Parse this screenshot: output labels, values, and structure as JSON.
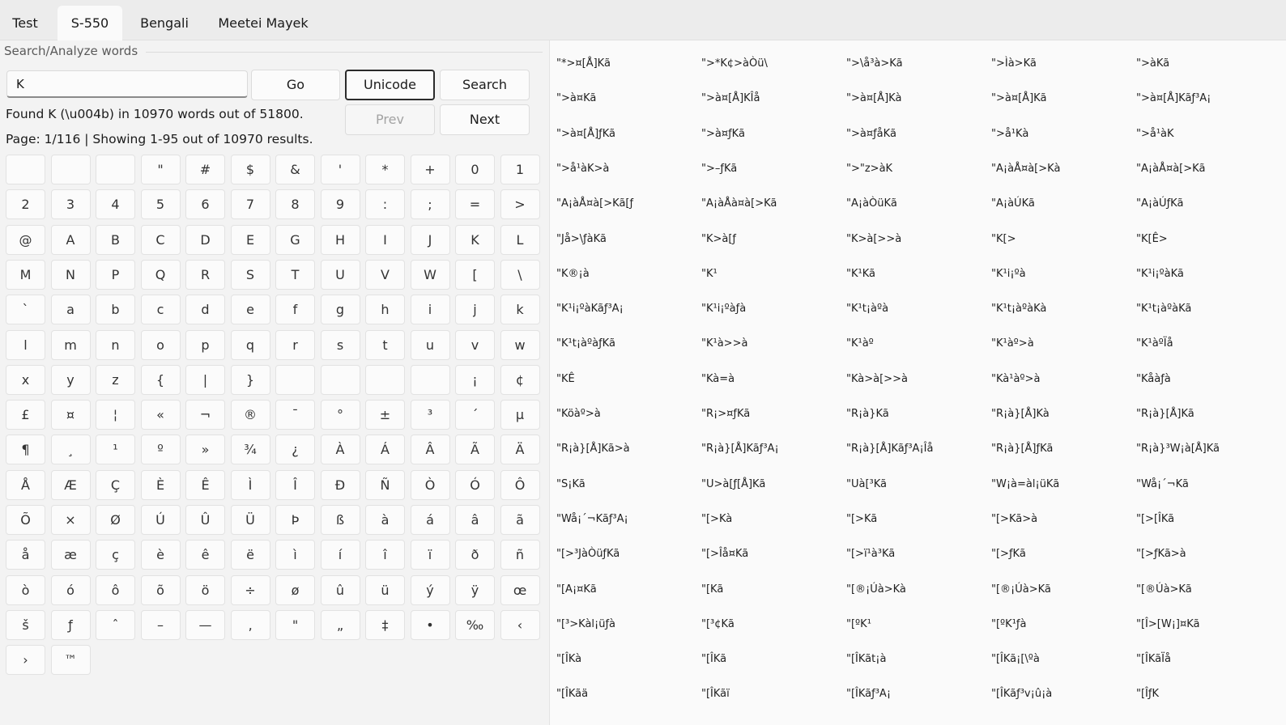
{
  "tabs": [
    "Test",
    "S-550",
    "Bengali",
    "Meetei Mayek"
  ],
  "active_tab": 1,
  "section_label": "Search/Analyze words",
  "search": {
    "value": "K",
    "placeholder": ""
  },
  "buttons": {
    "go": "Go",
    "unicode": "Unicode",
    "search": "Search",
    "prev": "Prev",
    "next": "Next"
  },
  "found_text": "Found K (\\u004b) in 10970 words out of 51800.",
  "page_text": "Page: 1/116 | Showing 1-95 out of 10970 results.",
  "keys": [
    "",
    "",
    "",
    "\"",
    "#",
    "$",
    "&",
    "'",
    "*",
    "+",
    "0",
    "1",
    "2",
    "3",
    "4",
    "5",
    "6",
    "7",
    "8",
    "9",
    ":",
    ";",
    "=",
    ">",
    "@",
    "A",
    "B",
    "C",
    "D",
    "E",
    "G",
    "H",
    "I",
    "J",
    "K",
    "L",
    "M",
    "N",
    "P",
    "Q",
    "R",
    "S",
    "T",
    "U",
    "V",
    "W",
    "[",
    "\\",
    "`",
    "a",
    "b",
    "c",
    "d",
    "e",
    "f",
    "g",
    "h",
    "i",
    "j",
    "k",
    "l",
    "m",
    "n",
    "o",
    "p",
    "q",
    "r",
    "s",
    "t",
    "u",
    "v",
    "w",
    "x",
    "y",
    "z",
    "{",
    "|",
    "}",
    "",
    "",
    "",
    "",
    "¡",
    "¢",
    "£",
    "¤",
    "¦",
    "«",
    "¬",
    "®",
    "¯",
    "°",
    "±",
    "³",
    "´",
    "µ",
    "¶",
    "¸",
    "¹",
    "º",
    "»",
    "¾",
    "¿",
    "À",
    "Á",
    "Â",
    "Ã",
    "Ä",
    "Å",
    "Æ",
    "Ç",
    "È",
    "Ê",
    "Ì",
    "Î",
    "Ð",
    "Ñ",
    "Ò",
    "Ó",
    "Ô",
    "Õ",
    "×",
    "Ø",
    "Ú",
    "Û",
    "Ü",
    "Þ",
    "ß",
    "à",
    "á",
    "â",
    "ã",
    "å",
    "æ",
    "ç",
    "è",
    "ê",
    "ë",
    "ì",
    "í",
    "î",
    "ï",
    "ð",
    "ñ",
    "ò",
    "ó",
    "ô",
    "õ",
    "ö",
    "÷",
    "ø",
    "û",
    "ü",
    "ý",
    "ÿ",
    "œ",
    "š",
    "ƒ",
    "ˆ",
    "–",
    "—",
    "‚",
    "\"",
    "„",
    "‡",
    "•",
    "‰",
    "‹",
    "›",
    "™"
  ],
  "results": [
    "\"*>¤[Å]Kã",
    "\">*K¢>àÒü\\",
    "\">\\å³à>Kã",
    "\">Ìà>Kã",
    "\">àKã",
    "\">à¤Kã",
    "\">à¤[Å]KÎå",
    "\">à¤[Å]Kà",
    "\">à¤[Å]Kã",
    "\">à¤[Å]Kãƒ³A¡",
    "\">à¤[Å]ƒKã",
    "\">à¤ƒKã",
    "\">à¤ƒåKã",
    "\">å¹Kà",
    "\">å¹àK",
    "\">å¹àK>à",
    "\">–ƒKã",
    "\">\"z>àK",
    "\"A¡àÅ¤à[>Kà",
    "\"A¡àÅ¤à[>Kã",
    "\"A¡àÅ¤à[>Kã[ƒ",
    "\"A¡àÅà¤à[>Kã",
    "\"A¡àÒüKã",
    "\"A¡àÚKã",
    "\"A¡àÚƒKã",
    "\"Jå>\\ƒàKã",
    "\"K>à[ƒ",
    "\"K>à[>>à",
    "\"K[>",
    "\"K[Ê>",
    "\"K®¡à",
    "\"K¹",
    "\"K¹Kã",
    "\"K¹i¡ºà",
    "\"K¹i¡ºàKã",
    "\"K¹i¡ºàKãƒ³A¡",
    "\"K¹i¡ºàƒà",
    "\"K¹t¡àºà",
    "\"K¹t¡àºàKà",
    "\"K¹t¡àºàKã",
    "\"K¹t¡àºàƒKã",
    "\"K¹à>>à",
    "\"K¹àº",
    "\"K¹àº>à",
    "\"K¹àºÏå",
    "\"KÊ",
    "\"Kà=à",
    "\"Kà>à[>>à",
    "\"Kà¹àº>à",
    "\"Kåàƒà",
    "\"Köàº>à",
    "\"R¡>¤ƒKã",
    "\"R¡à}Kã",
    "\"R¡à}[Å]Kà",
    "\"R¡à}[Å]Kã",
    "\"R¡à}[Å]Kã>à",
    "\"R¡à}[Å]Kãƒ³A¡",
    "\"R¡à}[Å]Kãƒ³A¡Îå",
    "\"R¡à}[Å]ƒKã",
    "\"R¡à}³W¡à[Å]Kã",
    "\"S¡Kã",
    "\"U>à[ƒ[Å]Kã",
    "\"Uà[³Kã",
    "\"W¡à=àl¡üKã",
    "\"Wå¡´¬Kã",
    "\"Wå¡´¬Kãƒ³A¡",
    "\"[>Kà",
    "\"[>Kã",
    "\"[>Kã>à",
    "\"[>[ÎKã",
    "\"[>³JàÒüƒKã",
    "\"[>Îå¤Kã",
    "\"[>ï¹à³Kã",
    "\"[>ƒKã",
    "\"[>ƒKã>à",
    "\"[A¡¤Kã",
    "\"[Kã",
    "\"[®¡Úà>Kà",
    "\"[®¡Úà>Kã",
    "\"[®Úà>Kã",
    "\"[³>Kàl¡üƒà",
    "\"[³¢Kã",
    "\"[ºK¹",
    "\"[ºK¹ƒà",
    "\"[Î>[W¡]¤Kã",
    "\"[ÎKà",
    "\"[ÎKã",
    "\"[ÎKãt¡à",
    "\"[ÎKã¡[\\ºà",
    "\"[ÎKãÏå",
    "\"[ÎKãä",
    "\"[ÎKãï",
    "\"[ÎKãƒ³A¡",
    "\"[ÎKãƒ³v¡û¡à",
    "\"[ÎƒK"
  ]
}
